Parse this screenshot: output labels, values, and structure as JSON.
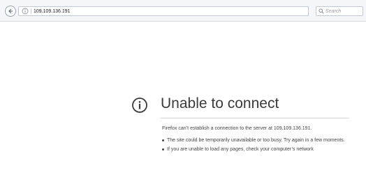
{
  "browser": {
    "url": "109.109.136.191",
    "search_placeholder": "Search",
    "icons": {
      "back": "back-arrow-icon",
      "site_info": "info-icon",
      "reload": "reload-icon",
      "search": "search-icon"
    }
  },
  "error_page": {
    "title": "Unable to connect",
    "description": "Firefox can’t establish a connection to the server at 109.109.136.191.",
    "bullets": [
      "The site could be temporarily unavailable or too busy. Try again in a few moments.",
      "If you are unable to load any pages, check your computer’s network"
    ],
    "icon": "info-circle-icon"
  }
}
